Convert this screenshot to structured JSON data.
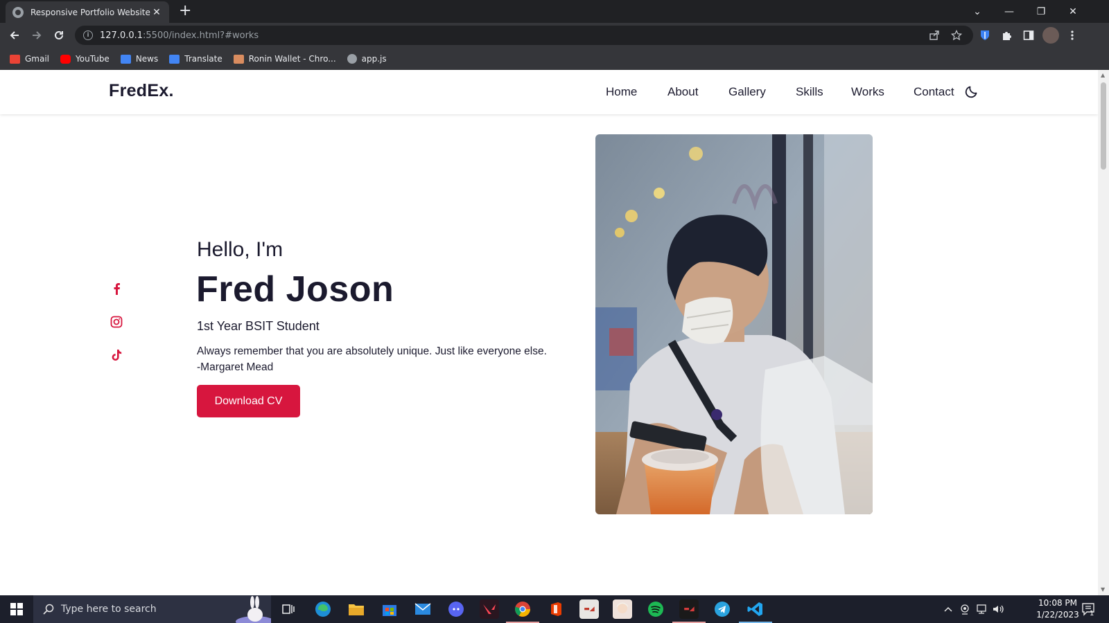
{
  "browser": {
    "tab_title": "Responsive Portfolio Website",
    "tab_close": "✕",
    "new_tab": "+",
    "window_controls": {
      "tabs_menu": "⌄",
      "minimize": "—",
      "restore": "❐",
      "close": "✕"
    },
    "url_host": "127.0.0.1",
    "url_rest": ":5500/index.html?#works",
    "bookmarks": [
      {
        "label": "Gmail",
        "icon": "gmail-icon",
        "color": "#ea4335"
      },
      {
        "label": "YouTube",
        "icon": "youtube-icon",
        "color": "#ff0000"
      },
      {
        "label": "News",
        "icon": "news-icon",
        "color": "#4285f4"
      },
      {
        "label": "Translate",
        "icon": "translate-icon",
        "color": "#4285f4"
      },
      {
        "label": "Ronin Wallet - Chro...",
        "icon": "ronin-wallet-icon",
        "color": "#d98c5f"
      },
      {
        "label": "app.js",
        "icon": "globe-icon",
        "color": "#9aa0a6"
      }
    ]
  },
  "site": {
    "logo": "FredEx.",
    "nav": [
      "Home",
      "About",
      "Gallery",
      "Skills",
      "Works",
      "Contact"
    ],
    "accent_color": "#d7163e",
    "text_color": "#1b1a2e"
  },
  "hero": {
    "greeting": "Hello, I'm",
    "name": "Fred Joson",
    "subtitle": "1st Year BSIT Student",
    "quote_line1": "Always remember that you are absolutely unique. Just like everyone else.",
    "quote_line2": "-Margaret Mead",
    "cta": "Download CV",
    "socials": [
      "facebook-icon",
      "instagram-icon",
      "tiktok-icon"
    ]
  },
  "taskbar": {
    "search_placeholder": "Type here to search",
    "time": "10:08 PM",
    "date": "1/22/2023",
    "notification_count": "1"
  }
}
